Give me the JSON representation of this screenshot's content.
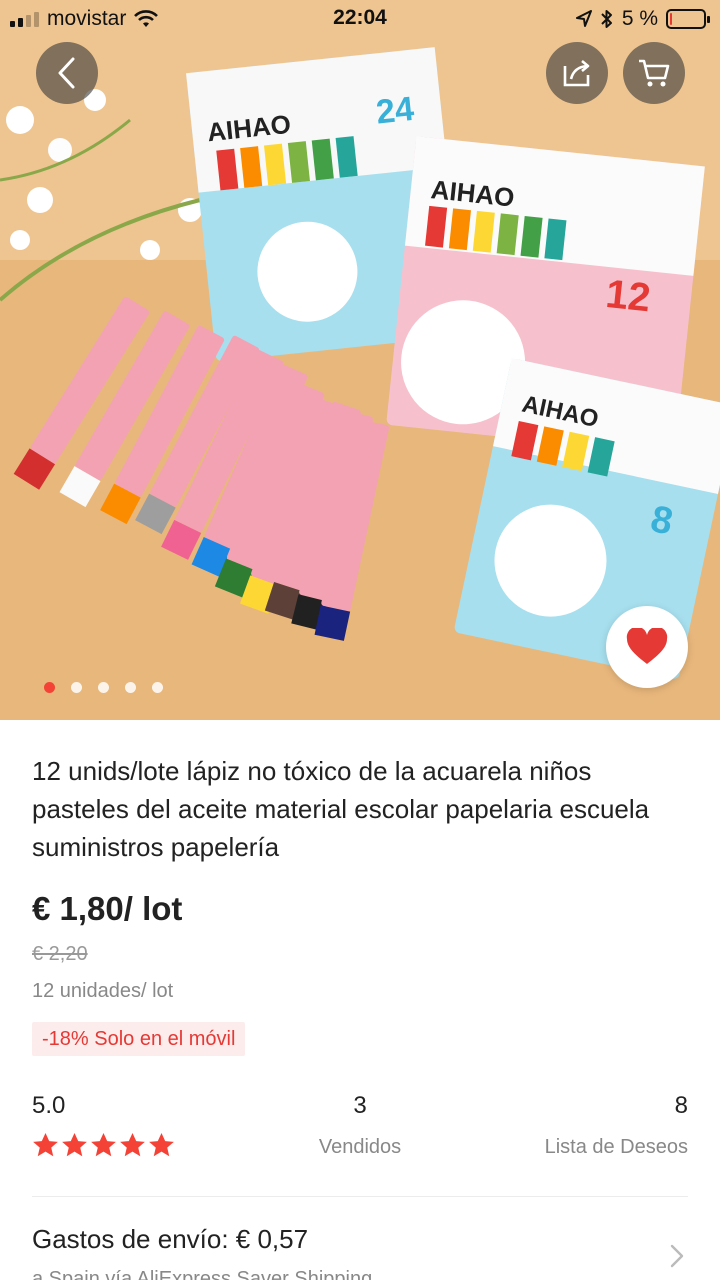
{
  "status_bar": {
    "carrier": "movistar",
    "time": "22:04",
    "battery": "5 %",
    "battery_level": 0.05
  },
  "hero": {
    "image_count": 5,
    "active_index": 0,
    "favorite": true
  },
  "product": {
    "title": "12 unids/lote lápiz no tóxico de la acuarela niños pasteles del aceite material escolar papelaria escuela suministros papelería",
    "price": "€ 1,80/ lot",
    "old_price": "€ 2,20",
    "unit": "12 unidades/ lot",
    "promo": "-18% Solo en el móvil"
  },
  "stats": {
    "rating": "5.0",
    "stars": 5,
    "sold": "3",
    "sold_label": "Vendidos",
    "wishlist": "8",
    "wishlist_label": "Lista de Deseos"
  },
  "shipping": {
    "title": "Gastos de envío: € 0,57",
    "subtitle": "a Spain vía AliExpress Saver Shipping"
  },
  "colors": {
    "accent": "#e53935",
    "star": "#f44336",
    "promo_bg": "#fdecec"
  }
}
